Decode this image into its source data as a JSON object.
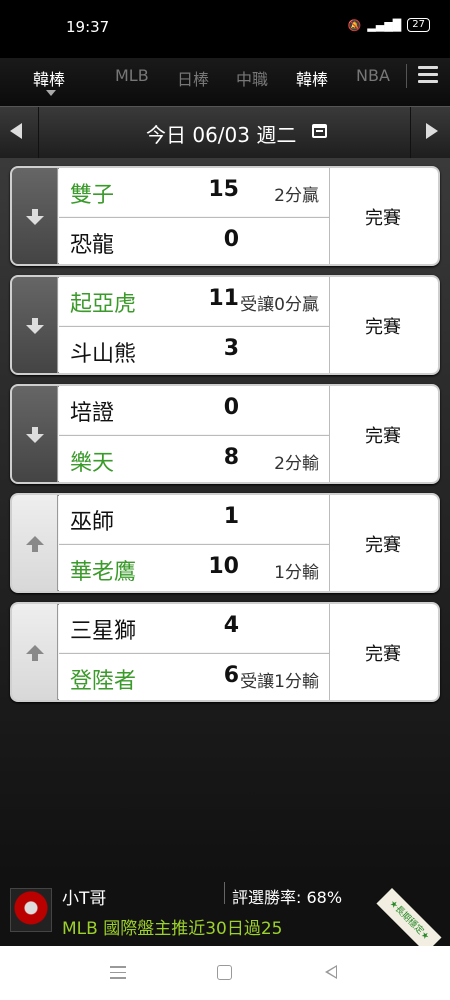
{
  "status_bar": {
    "time": "19:37",
    "battery": "27"
  },
  "league_tabs": [
    {
      "label": "韓棒",
      "active": true
    },
    {
      "label": "MLB",
      "active": false
    },
    {
      "label": "日棒",
      "active": false
    },
    {
      "label": "中職",
      "active": false
    },
    {
      "label": "韓棒",
      "active": false
    },
    {
      "label": "NBA",
      "active": false
    }
  ],
  "date_nav": {
    "label": "今日 06/03 週二"
  },
  "games": [
    {
      "away": {
        "name": "雙子",
        "score": "15",
        "result": "2分贏"
      },
      "home": {
        "name": "恐龍",
        "score": "0",
        "result": ""
      },
      "status": "完賽",
      "winner": "away",
      "direction": "down"
    },
    {
      "away": {
        "name": "起亞虎",
        "score": "11",
        "result": "受讓0分贏"
      },
      "home": {
        "name": "斗山熊",
        "score": "3",
        "result": ""
      },
      "status": "完賽",
      "winner": "away",
      "direction": "down"
    },
    {
      "away": {
        "name": "培證",
        "score": "0",
        "result": ""
      },
      "home": {
        "name": "樂天",
        "score": "8",
        "result": "2分輸"
      },
      "status": "完賽",
      "winner": "home",
      "direction": "down"
    },
    {
      "away": {
        "name": "巫師",
        "score": "1",
        "result": ""
      },
      "home": {
        "name": "華老鷹",
        "score": "10",
        "result": "1分輸"
      },
      "status": "完賽",
      "winner": "home",
      "direction": "up"
    },
    {
      "away": {
        "name": "三星獅",
        "score": "4",
        "result": ""
      },
      "home": {
        "name": "登陸者",
        "score": "6",
        "result": "受讓1分輸"
      },
      "status": "完賽",
      "winner": "home",
      "direction": "up"
    }
  ],
  "banner": {
    "expert_name": "小T哥",
    "win_rate": "評選勝率: 68%",
    "pick": "MLB 國際盤主推近30日過25",
    "ribbon": "★長期穩定★"
  },
  "colors": {
    "winner": "#3a9a2a",
    "pick_text": "#9cd02a"
  }
}
